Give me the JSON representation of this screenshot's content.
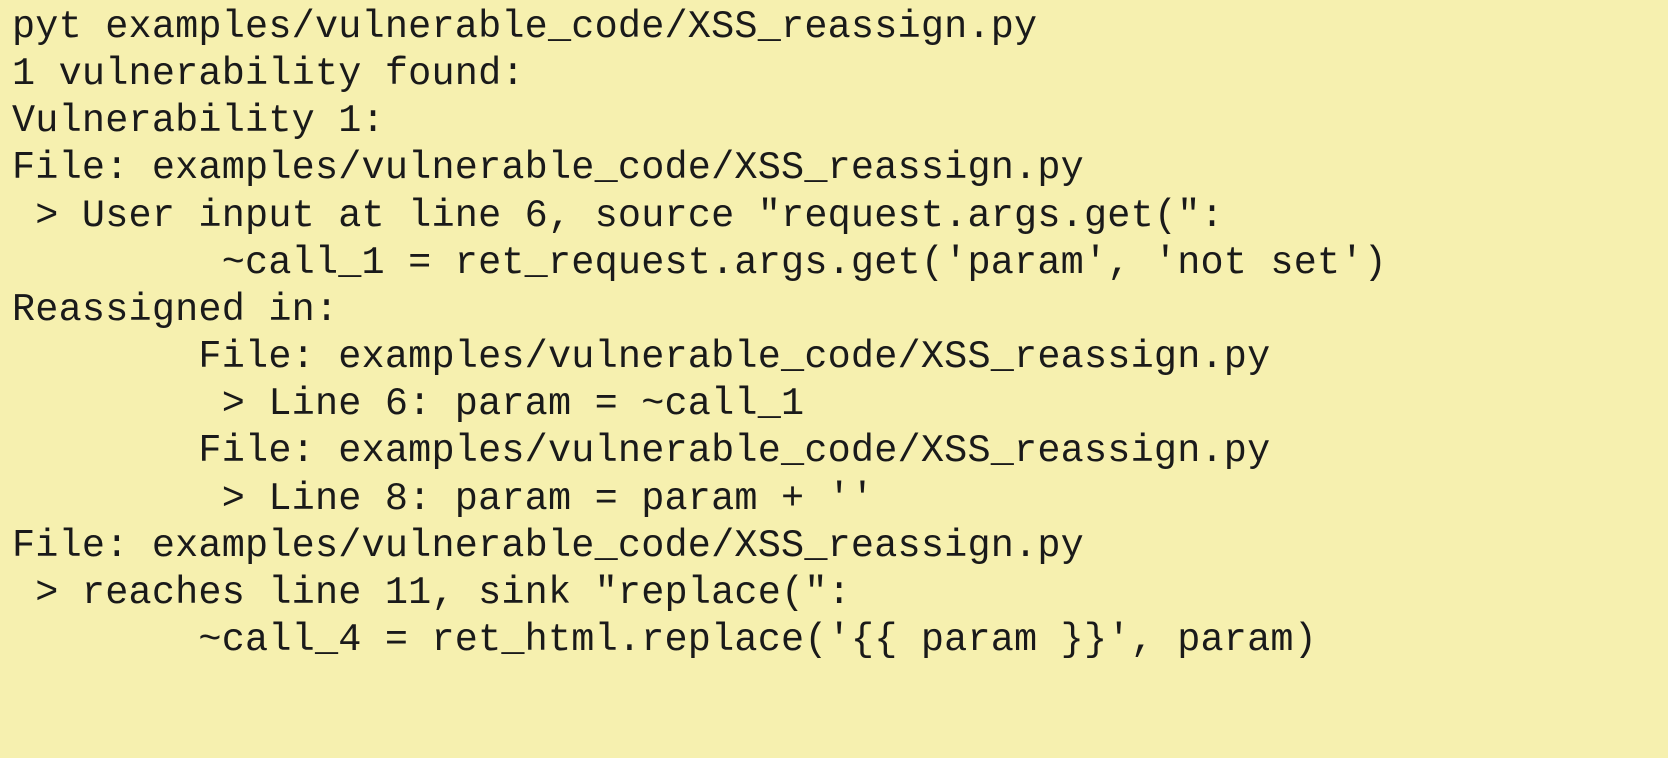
{
  "output": {
    "lines": [
      "pyt examples/vulnerable_code/XSS_reassign.py",
      "1 vulnerability found:",
      "Vulnerability 1:",
      "File: examples/vulnerable_code/XSS_reassign.py",
      " > User input at line 6, source \"request.args.get(\":",
      "         ~call_1 = ret_request.args.get('param', 'not set')",
      "Reassigned in:",
      "        File: examples/vulnerable_code/XSS_reassign.py",
      "         > Line 6: param = ~call_1",
      "        File: examples/vulnerable_code/XSS_reassign.py",
      "         > Line 8: param = param + ''",
      "File: examples/vulnerable_code/XSS_reassign.py",
      " > reaches line 11, sink \"replace(\":",
      "        ~call_4 = ret_html.replace('{{ param }}', param)"
    ]
  }
}
